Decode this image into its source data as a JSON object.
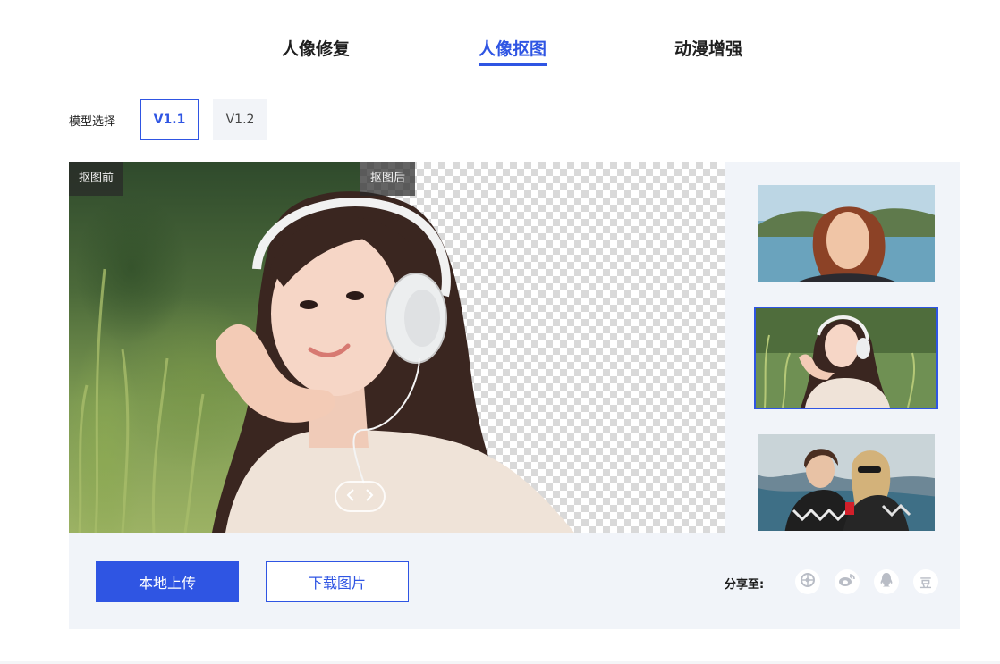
{
  "tabs": [
    {
      "label": "人像修复",
      "active": false
    },
    {
      "label": "人像抠图",
      "active": true
    },
    {
      "label": "动漫增强",
      "active": false
    }
  ],
  "model": {
    "label": "模型选择",
    "options": [
      {
        "label": "V1.1",
        "selected": true
      },
      {
        "label": "V1.2",
        "selected": false
      }
    ]
  },
  "preview": {
    "before_tag": "抠图前",
    "after_tag": "抠图后",
    "handle_icons": [
      "chevron-left-icon",
      "chevron-right-icon"
    ]
  },
  "thumbnails": [
    {
      "name": "thumbnail-redhead-woman-lake",
      "selected": false
    },
    {
      "name": "thumbnail-woman-headphones",
      "selected": true
    },
    {
      "name": "thumbnail-two-friends-cliff",
      "selected": false
    }
  ],
  "actions": {
    "upload_label": "本地上传",
    "download_label": "下载图片"
  },
  "share": {
    "label": "分享至:",
    "targets": [
      {
        "name": "wechat-moments-icon"
      },
      {
        "name": "weibo-icon"
      },
      {
        "name": "qq-icon"
      },
      {
        "name": "douban-icon",
        "text": "豆"
      }
    ]
  },
  "colors": {
    "accent": "#2f55e3",
    "panel_bg": "#f1f4f9",
    "tab_text": "#1f1f1f",
    "share_icon": "#b9bdc6"
  }
}
